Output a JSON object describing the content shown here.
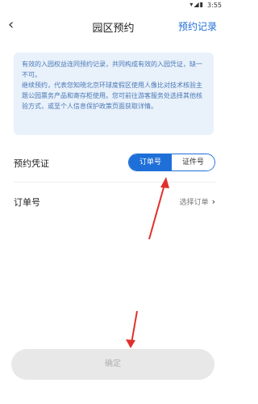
{
  "status_bar": {
    "time": "3:55",
    "icons": "▾◢▮"
  },
  "header": {
    "back_icon": "back-chevron-icon",
    "title": "园区预约",
    "records_label": "预约记录"
  },
  "notice": {
    "line1": "有效的入园权益连同预约记录，共同构成有效的入园凭证，缺一不可。",
    "line2": "继续预约，代表您知晓北京环球度假区使用人像比对技术核验主题公园票务产品和寄存柜使用。您可前往游客服务处选择其他核验方式，或至个人信息保护政策页面获取详情。"
  },
  "voucher": {
    "label": "预约凭证",
    "options": [
      "订单号",
      "证件号"
    ],
    "selected": "订单号"
  },
  "order": {
    "label": "订单号",
    "select_label": "选择订单"
  },
  "confirm_label": "确定",
  "colors": {
    "accent": "#1f6fd8",
    "notice_bg": "#e9f1fb",
    "arrow": "#e0302c"
  }
}
